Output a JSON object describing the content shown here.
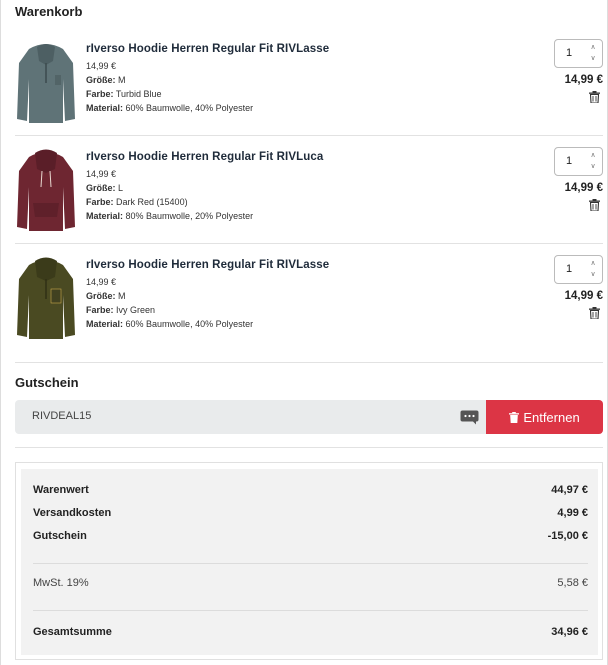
{
  "cart": {
    "title": "Warenkorb",
    "items": [
      {
        "title": "rIverso Hoodie Herren Regular Fit RIVLasse",
        "unit_price": "14,99 €",
        "size_label": "Größe:",
        "size": "M",
        "color_label": "Farbe:",
        "color": "Turbid Blue",
        "material_label": "Material:",
        "material": "60% Baumwolle, 40% Polyester",
        "quantity": "1",
        "total": "14,99 €",
        "swatch": "#5f7377"
      },
      {
        "title": "rIverso Hoodie Herren Regular Fit RIVLuca",
        "unit_price": "14,99 €",
        "size_label": "Größe:",
        "size": "L",
        "color_label": "Farbe:",
        "color": "Dark Red (15400)",
        "material_label": "Material:",
        "material": "80% Baumwolle, 20% Polyester",
        "quantity": "1",
        "total": "14,99 €",
        "swatch": "#6e2631"
      },
      {
        "title": "rIverso Hoodie Herren Regular Fit RIVLasse",
        "unit_price": "14,99 €",
        "size_label": "Größe:",
        "size": "M",
        "color_label": "Farbe:",
        "color": "Ivy Green",
        "material_label": "Material:",
        "material": "60% Baumwolle, 40% Polyester",
        "quantity": "1",
        "total": "14,99 €",
        "swatch": "#4a4a22"
      }
    ]
  },
  "voucher": {
    "title": "Gutschein",
    "code": "RIVDEAL15",
    "remove_label": "Entfernen",
    "remove_color": "#dc3545"
  },
  "summary": {
    "goods_label": "Warenwert",
    "goods_value": "44,97 €",
    "shipping_label": "Versandkosten",
    "shipping_value": "4,99 €",
    "voucher_label": "Gutschein",
    "voucher_value": "-15,00 €",
    "vat_label": "MwSt. 19%",
    "vat_value": "5,58 €",
    "total_label": "Gesamtsumme",
    "total_value": "34,96 €"
  }
}
